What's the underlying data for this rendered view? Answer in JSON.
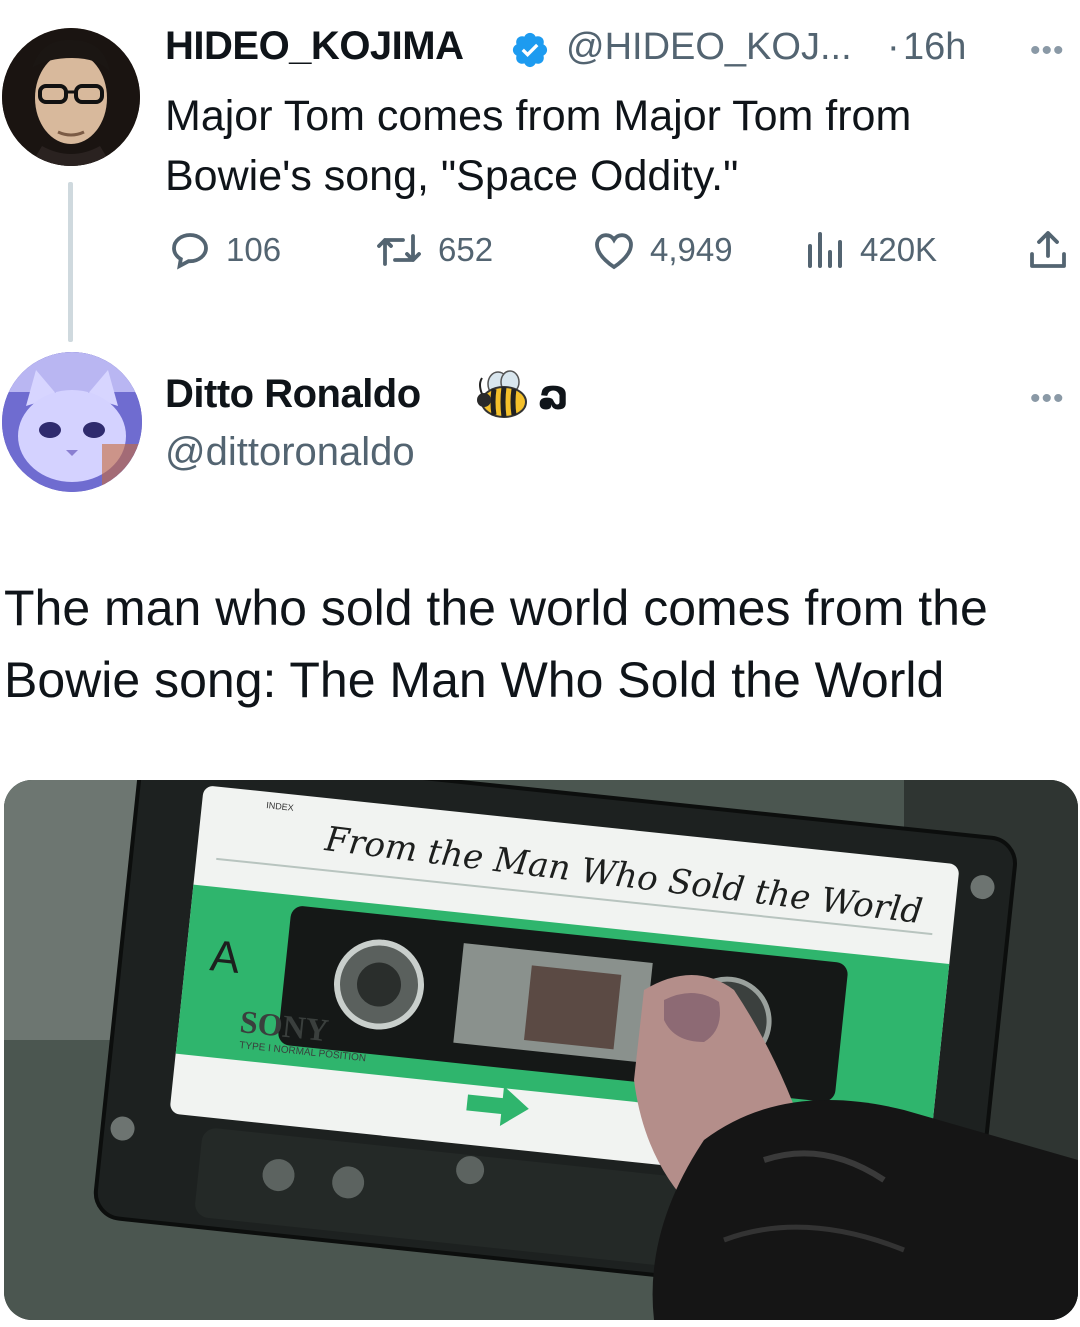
{
  "tweet1": {
    "display_name": "HIDEO_KOJIMA",
    "handle": "@HIDEO_KOJ...",
    "separator": "·",
    "time": "16h",
    "text": "Major Tom comes from Major Tom from Bowie's song, \"Space Oddity.\"",
    "stats": {
      "replies": "106",
      "reposts": "652",
      "likes": "4,949",
      "views": "420K"
    }
  },
  "tweet2": {
    "display_name": "Ditto Ronaldo",
    "name_suffix": "ລ",
    "handle": "@dittoronaldo",
    "text": "The man who sold the world comes from the Bowie song: The Man Who Sold the World"
  },
  "media": {
    "label_text": "From the Man Who Sold the World",
    "brand": "SONY",
    "side": "A",
    "small_caption": "TYPE I NORMAL POSITION",
    "index": "INDEX"
  },
  "colors": {
    "text": "#0f1419",
    "secondary": "#536471",
    "verified": "#1d9bf0",
    "cassette_green": "#2fb56d"
  },
  "more_label": "•••"
}
